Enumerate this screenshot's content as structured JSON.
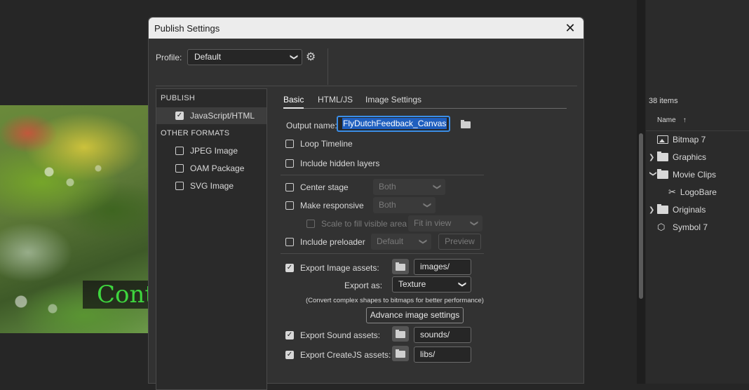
{
  "stage": {
    "overlay_text": "Cont"
  },
  "library": {
    "item_count": "38 items",
    "column_name": "Name",
    "sort_arrow": "↑",
    "items": [
      {
        "label": "Bitmap 7",
        "icon": "bitmap-icon",
        "expandable": false
      },
      {
        "label": "Graphics",
        "icon": "folder-icon",
        "expandable": true,
        "expanded": false
      },
      {
        "label": "Movie Clips",
        "icon": "folder-icon",
        "expandable": true,
        "expanded": true
      },
      {
        "label": "LogoBare",
        "icon": "movieclip-icon",
        "expandable": false
      },
      {
        "label": "Originals",
        "icon": "folder-icon",
        "expandable": true,
        "expanded": false
      },
      {
        "label": "Symbol 7",
        "icon": "graphic-symbol-icon",
        "expandable": false
      }
    ]
  },
  "dialog": {
    "title": "Publish Settings",
    "close_glyph": "✕",
    "profile_label": "Profile:",
    "profile_value": "Default",
    "publish_header": "PUBLISH",
    "publish_items": [
      {
        "label": "JavaScript/HTML",
        "checked": true
      }
    ],
    "other_header": "OTHER FORMATS",
    "other_items": [
      {
        "label": "JPEG Image",
        "checked": false
      },
      {
        "label": "OAM Package",
        "checked": false
      },
      {
        "label": "SVG Image",
        "checked": false
      }
    ],
    "tabs": [
      {
        "label": "Basic",
        "active": true
      },
      {
        "label": "HTML/JS",
        "active": false
      },
      {
        "label": "Image Settings",
        "active": false
      }
    ],
    "basic": {
      "output_name_label": "Output name:",
      "output_name_value": "FlyDutchFeedback_Canvas",
      "loop_timeline": {
        "label": "Loop Timeline",
        "checked": false
      },
      "include_hidden_layers": {
        "label": "Include hidden layers",
        "checked": false
      },
      "center_stage": {
        "label": "Center stage",
        "checked": false,
        "option": "Both"
      },
      "make_responsive": {
        "label": "Make responsive",
        "checked": false,
        "option": "Both"
      },
      "scale_to_fill": {
        "label": "Scale to fill visible area",
        "checked": false,
        "option": "Fit in view"
      },
      "include_preloader": {
        "label": "Include preloader",
        "checked": false,
        "option": "Default",
        "preview_label": "Preview"
      },
      "export_image_assets": {
        "label": "Export Image assets:",
        "checked": true,
        "path": "images/"
      },
      "export_as_label": "Export as:",
      "export_as_value": "Texture",
      "export_note": "(Convert complex shapes to bitmaps for better performance)",
      "advance_button": "Advance image settings",
      "export_sound_assets": {
        "label": "Export Sound assets:",
        "checked": true,
        "path": "sounds/"
      },
      "export_createjs_assets": {
        "label": "Export CreateJS assets:",
        "checked": true,
        "path": "libs/"
      }
    }
  }
}
